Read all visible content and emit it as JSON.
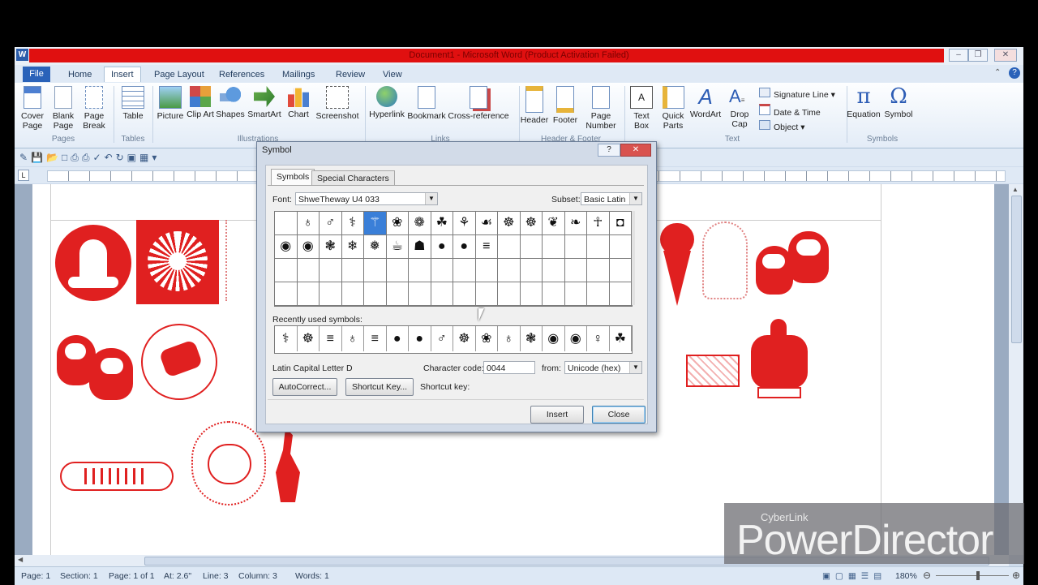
{
  "window": {
    "title": "Document1 - Microsoft Word (Product Activation Failed)",
    "controls": [
      "minimize-icon",
      "restore-icon",
      "close-icon"
    ]
  },
  "ribbon": {
    "file_tab": "File",
    "tabs": [
      "Home",
      "Insert",
      "Page Layout",
      "References",
      "Mailings",
      "Review",
      "View"
    ],
    "active_tab": "Insert",
    "pages_group": {
      "label": "Pages",
      "buttons": [
        "Cover Page",
        "Blank Page",
        "Page Break"
      ]
    },
    "tables_group": {
      "label": "Tables",
      "buttons": [
        "Table"
      ]
    },
    "illustrations_group": {
      "label": "Illustrations",
      "buttons": [
        "Picture",
        "Clip Art",
        "Shapes",
        "SmartArt",
        "Chart",
        "Screenshot"
      ]
    },
    "links_group": {
      "label": "Links",
      "buttons": [
        "Hyperlink",
        "Bookmark",
        "Cross-reference"
      ]
    },
    "header_group": {
      "label": "Header & Footer",
      "buttons": [
        "Header",
        "Footer",
        "Page Number"
      ]
    },
    "text_group": {
      "label": "Text",
      "buttons": [
        "Text Box",
        "Quick Parts",
        "WordArt",
        "Drop Cap"
      ],
      "side_items": [
        "Signature Line",
        "Date & Time",
        "Object"
      ]
    },
    "symbols_group": {
      "label": "Symbols",
      "buttons": [
        "Equation",
        "Symbol"
      ]
    }
  },
  "dialog": {
    "title": "Symbol",
    "tabs": [
      "Symbols",
      "Special Characters"
    ],
    "font_label": "Font:",
    "font_value": "ShweTheway U4 033",
    "subset_label": "Subset:",
    "subset_value": "Basic Latin",
    "recent_label": "Recently used symbols:",
    "char_name": "Latin Capital Letter D",
    "char_code_label": "Character code:",
    "char_code_value": "0044",
    "from_label": "from:",
    "from_value": "Unicode (hex)",
    "autocorrect_btn": "AutoCorrect...",
    "shortcut_btn": "Shortcut Key...",
    "shortcut_key_label": "Shortcut key:",
    "insert_btn": "Insert",
    "close_btn": "Close"
  },
  "status_bar": {
    "page": "Page: 1",
    "section": "Section: 1",
    "page_of": "Page: 1 of 1",
    "at": "At: 2.6\"",
    "line": "Line: 3",
    "column": "Column: 3",
    "words": "Words: 1",
    "zoom": "180%"
  },
  "watermark": {
    "small": "CyberLink",
    "big": "PowerDirector"
  },
  "colors": {
    "title_red": "#e01010",
    "accent_blue": "#2a62b9",
    "clipart_red": "#e02020"
  }
}
